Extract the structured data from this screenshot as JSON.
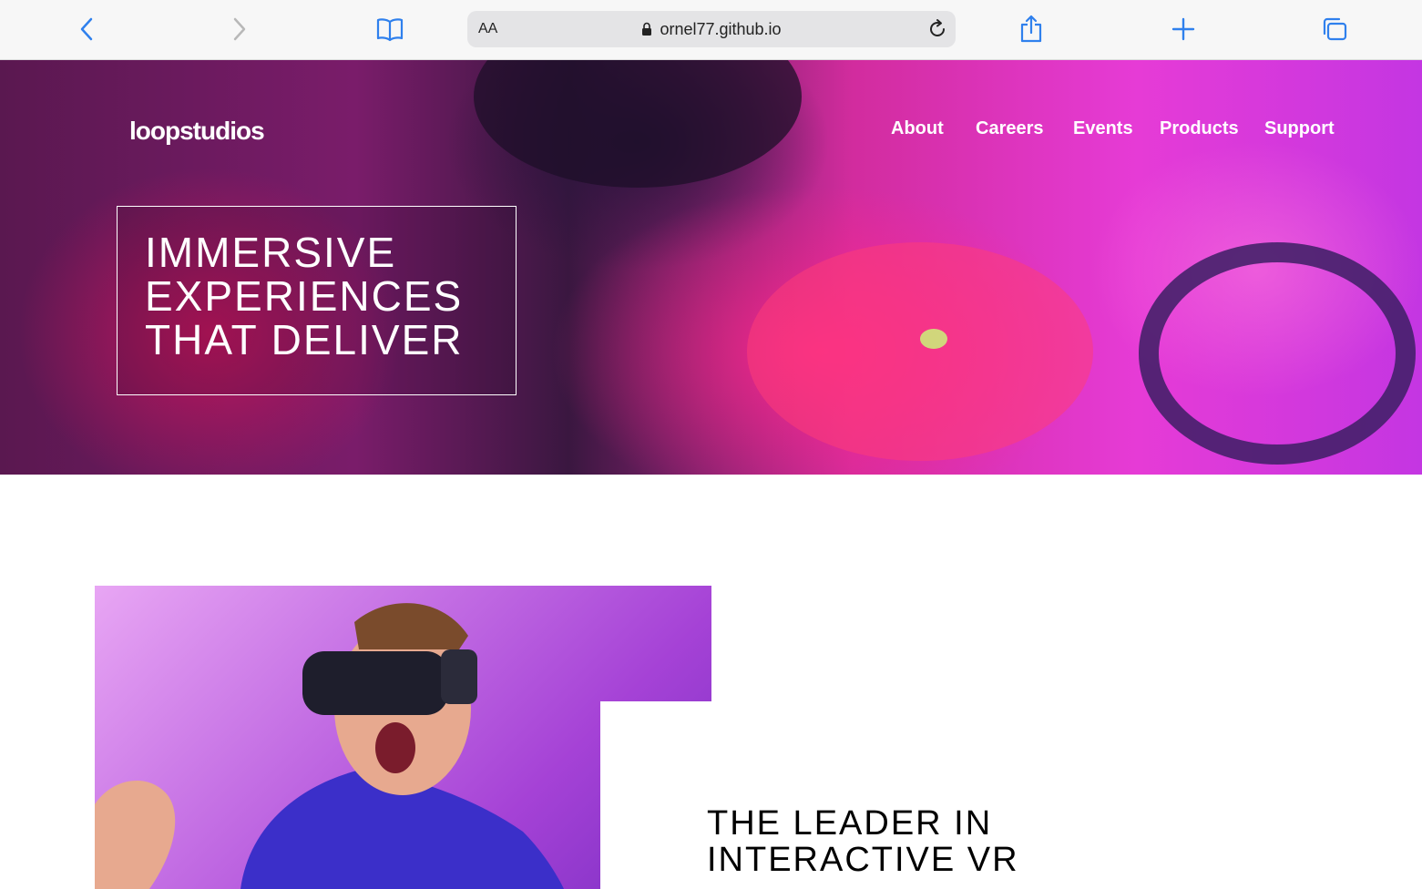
{
  "browser": {
    "aa_label": "AA",
    "url": "ornel77.github.io",
    "icons": [
      "back-icon",
      "forward-icon",
      "bookmarks-icon",
      "lock-icon",
      "reload-icon",
      "share-icon",
      "new-tab-icon",
      "tabs-icon"
    ]
  },
  "hero": {
    "logo": "loopstudios",
    "nav": [
      "About",
      "Careers",
      "Events",
      "Products",
      "Support"
    ],
    "headline": [
      "IMMERSIVE",
      "EXPERIENCES",
      "THAT DELIVER"
    ]
  },
  "feature": {
    "title": [
      "THE LEADER IN",
      "INTERACTIVE VR"
    ]
  },
  "colors": {
    "toolbar_bg": "#f7f7f7",
    "toolbar_icon": "#1a73e8",
    "hero_magenta": "#e63bd6",
    "hero_pink": "#ff2b8c",
    "feature_purple": "#a542d6"
  }
}
